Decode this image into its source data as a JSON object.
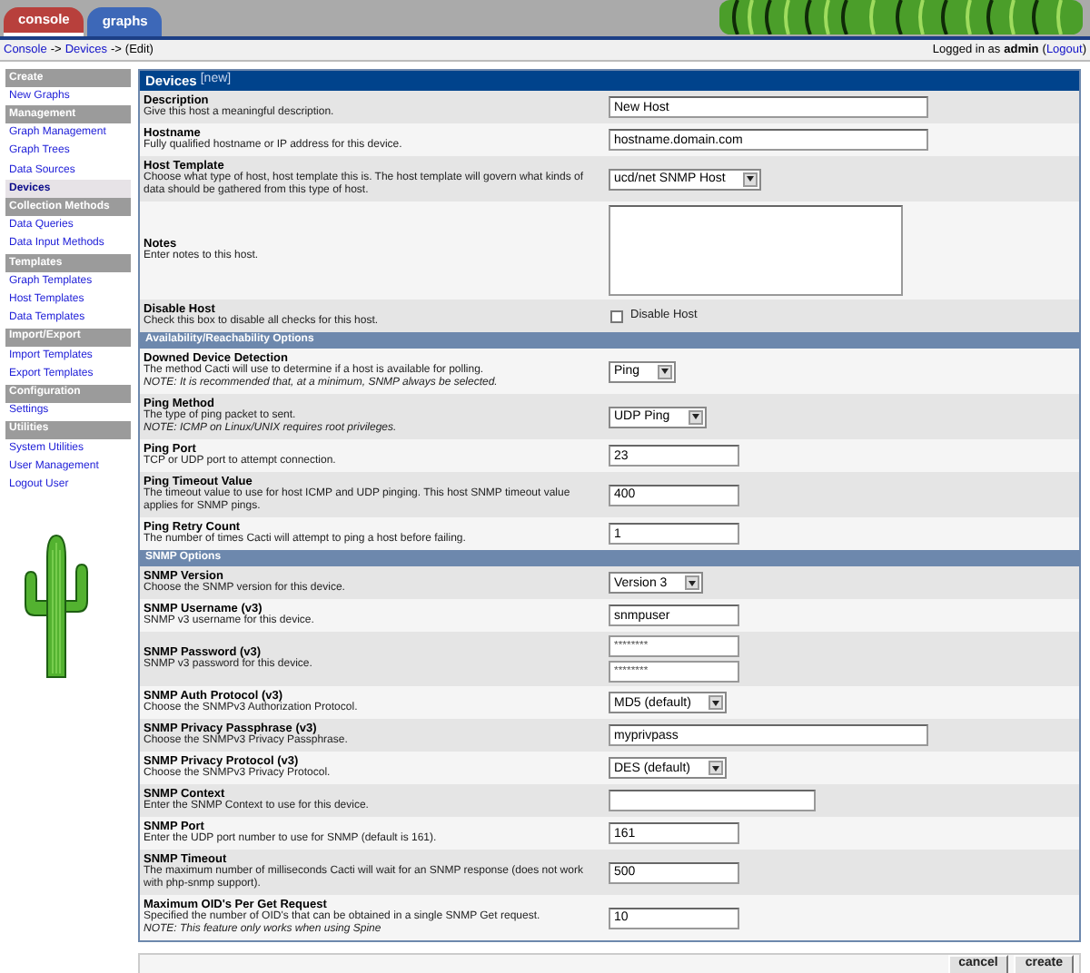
{
  "tabs": [
    {
      "label": "console",
      "selected": true,
      "color": "#b8403c"
    },
    {
      "label": "graphs",
      "selected": false,
      "color": "#3d68b8"
    }
  ],
  "breadcrumb": {
    "links": [
      "Console",
      "Devices"
    ],
    "separators": [
      "->",
      "->"
    ],
    "current": "(Edit)"
  },
  "login": {
    "prefix": "Logged in as",
    "user": "admin",
    "logout": "Logout",
    "open": "(",
    "close": ")"
  },
  "sidebar": [
    {
      "kind": "header",
      "label": "Create"
    },
    {
      "kind": "item",
      "label": "New Graphs",
      "selected": false
    },
    {
      "kind": "header",
      "label": "Management"
    },
    {
      "kind": "item",
      "label": "Graph Management",
      "selected": false
    },
    {
      "kind": "item",
      "label": "Graph Trees",
      "selected": false
    },
    {
      "kind": "item",
      "label": "Data Sources",
      "selected": false
    },
    {
      "kind": "item",
      "label": "Devices",
      "selected": true
    },
    {
      "kind": "header",
      "label": "Collection Methods"
    },
    {
      "kind": "item",
      "label": "Data Queries",
      "selected": false
    },
    {
      "kind": "item",
      "label": "Data Input Methods",
      "selected": false
    },
    {
      "kind": "header",
      "label": "Templates"
    },
    {
      "kind": "item",
      "label": "Graph Templates",
      "selected": false
    },
    {
      "kind": "item",
      "label": "Host Templates",
      "selected": false
    },
    {
      "kind": "item",
      "label": "Data Templates",
      "selected": false
    },
    {
      "kind": "header",
      "label": "Import/Export"
    },
    {
      "kind": "item",
      "label": "Import Templates",
      "selected": false
    },
    {
      "kind": "item",
      "label": "Export Templates",
      "selected": false
    },
    {
      "kind": "header",
      "label": "Configuration"
    },
    {
      "kind": "item",
      "label": "Settings",
      "selected": false
    },
    {
      "kind": "header",
      "label": "Utilities"
    },
    {
      "kind": "item",
      "label": "System Utilities",
      "selected": false
    },
    {
      "kind": "item",
      "label": "User Management",
      "selected": false
    },
    {
      "kind": "item",
      "label": "Logout User",
      "selected": false
    }
  ],
  "form": {
    "title": "Devices",
    "tag": "[new]",
    "sections": [
      {
        "rows": [
          {
            "title": "Description",
            "description": "Give this host a meaningful description.",
            "kind": "text",
            "value": "New Host"
          },
          {
            "title": "Hostname",
            "description": "Fully qualified hostname or IP address for this device.",
            "kind": "text",
            "value": "hostname.domain.com"
          },
          {
            "title": "Host Template",
            "description": "Choose what type of host, host template this is. The host template will govern what kinds of data should be gathered from this type of host.",
            "kind": "select",
            "value": "ucd/net SNMP Host"
          },
          {
            "title": "Notes",
            "description": "Enter notes to this host.",
            "kind": "textarea"
          },
          {
            "title": "Disable Host",
            "description": "Check this box to disable all checks for this host.",
            "kind": "checkbox",
            "label": "Disable Host",
            "checked": false
          }
        ]
      },
      {
        "title": "Availability/Reachability Options",
        "rows": [
          {
            "title": "Downed Device Detection",
            "description": "The method Cacti will use to determine if a host is available for polling.",
            "note": "NOTE: It is recommended that, at a minimum, SNMP always be selected.",
            "kind": "select",
            "value": "Ping"
          },
          {
            "title": "Ping Method",
            "description": "The type of ping packet to sent.",
            "note": "NOTE: ICMP on Linux/UNIX requires root privileges.",
            "kind": "select",
            "value": "UDP Ping"
          },
          {
            "title": "Ping Port",
            "description": "TCP or UDP port to attempt connection.",
            "kind": "short",
            "value": "23"
          },
          {
            "title": "Ping Timeout Value",
            "description": "The timeout value to use for host ICMP and UDP pinging. This host SNMP timeout value applies for SNMP pings.",
            "kind": "short",
            "value": "400"
          },
          {
            "title": "Ping Retry Count",
            "description": "The number of times Cacti will attempt to ping a host before failing.",
            "kind": "short",
            "value": "1"
          }
        ]
      },
      {
        "title": "SNMP Options",
        "rows": [
          {
            "title": "SNMP Version",
            "description": "Choose the SNMP version for this device.",
            "kind": "select",
            "value": "Version 3"
          },
          {
            "title": "SNMP Username (v3)",
            "description": "SNMP v3 username for this device.",
            "kind": "short",
            "value": "snmpuser"
          },
          {
            "title": "SNMP Password (v3)",
            "description": "SNMP v3 password for this device.",
            "kind": "password",
            "value": "********",
            "confirm": "********"
          },
          {
            "title": "SNMP Auth Protocol (v3)",
            "description": "Choose the SNMPv3 Authorization Protocol.",
            "kind": "select",
            "value": "MD5 (default)"
          },
          {
            "title": "SNMP Privacy Passphrase (v3)",
            "description": "Choose the SNMPv3 Privacy Passphrase.",
            "kind": "text",
            "value": "myprivpass"
          },
          {
            "title": "SNMP Privacy Protocol (v3)",
            "description": "Choose the SNMPv3 Privacy Protocol.",
            "kind": "select",
            "value": "DES (default)"
          },
          {
            "title": "SNMP Context",
            "description": "Enter the SNMP Context to use for this device.",
            "kind": "medium",
            "value": ""
          },
          {
            "title": "SNMP Port",
            "description": "Enter the UDP port number to use for SNMP (default is 161).",
            "kind": "short",
            "value": "161"
          },
          {
            "title": "SNMP Timeout",
            "description": "The maximum number of milliseconds Cacti will wait for an SNMP response (does not work with php-snmp support).",
            "kind": "short",
            "value": "500"
          },
          {
            "title": "Maximum OID's Per Get Request",
            "description": "Specified the number of OID's that can be obtained in a single SNMP Get request.",
            "note": "NOTE: This feature only works when using Spine",
            "kind": "short",
            "value": "10"
          }
        ]
      }
    ]
  },
  "buttons": [
    "cancel",
    "create"
  ]
}
